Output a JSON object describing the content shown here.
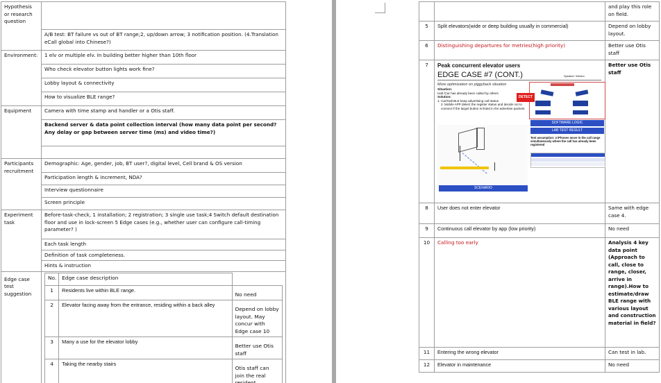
{
  "left_page": {
    "rows": [
      {
        "label": "Hypothesis or research question",
        "items": [
          "",
          "A/B test: BT failure vs out of BT range;2, up/down arrow; 3 notification position. (4.Translation eCall global into Chinese?)"
        ]
      },
      {
        "label": "Environment:",
        "items": [
          "1 elv or multiple elv. In building better higher than 10th floor",
          "Who check elevator button lights work fine?",
          "Lobby layout  & connectivity",
          "How to visualize BLE range?"
        ]
      },
      {
        "label": "Equipment",
        "items": [
          "Camera with time stamp and handler or a Otis staff.",
          "Backend server & data point collection interval (how many data point per second? Any delay or gap between server time (ms) and video time?)",
          ""
        ]
      },
      {
        "label": "Participants recruitment",
        "items": [
          "Demographic: Age, gender, job, BT user?, digital level, Cell brand & OS version",
          "Participation length & increment, NDA?",
          "Interview questionnaire",
          "Screen principle"
        ]
      },
      {
        "label": "Experiment task",
        "items": [
          "Before-task-check, 1 installation; 2 registration; 3 single use task;4 Switch default destination floor and use in lock-screen 5 Edge cases (e.g., whether user can configure call-timing  parameter? )",
          "Each task length",
          "Definition of task completeness.",
          "Hints & instruction"
        ]
      },
      {
        "label": "Edge case test suggestion"
      }
    ],
    "edge_header": {
      "no": "No.",
      "desc": "Edge case description"
    },
    "edge_cases": [
      {
        "no": "1",
        "desc": "Residents live within BLE range.",
        "note": "No need"
      },
      {
        "no": "2",
        "desc": "Elevator facing away from the entrance, residing within a back alley",
        "note": "Depend on lobby layout.  May concur with Edge case 10"
      },
      {
        "no": "3",
        "desc": "Many a use for the elevator lobby",
        "note": "Better use Otis staff"
      },
      {
        "no": "4",
        "desc": "Taking the nearby stairs",
        "note": "Otis staff can join the real resident"
      }
    ]
  },
  "right_page": {
    "rows": [
      {
        "no": "",
        "desc": "",
        "note": "and play this role on field."
      },
      {
        "no": "5",
        "desc": "Split elevators(wide or deep building usually in commercial)",
        "note": "Depend on lobby layout."
      },
      {
        "no": "6",
        "desc": "Distinguishing departures for metries(high priority)",
        "note": "Better use Otis staff"
      },
      {
        "no": "7",
        "desc": "Peak concurrent elevator users",
        "note": "Better use Otis staff"
      },
      {
        "no": "8",
        "desc": "User does not enter elevator",
        "note": "Same with edge case 4."
      },
      {
        "no": "9",
        "desc": "Continuous call elevator by app (low priority)",
        "note": "No need"
      },
      {
        "no": "10",
        "desc": "Calling too early",
        "note": "Analysis 4 key data point (Approach to call, close to range, closer, arrive in range).How to estimate/draw BLE range with various layout and construction material in field?"
      },
      {
        "no": "11",
        "desc": "Entering the wrong elevator",
        "note": "Can test in lab."
      },
      {
        "no": "12",
        "desc": "Elevator in maintenance",
        "note": "No need"
      }
    ],
    "slide": {
      "title": "EDGE CASE #7 (CONT.)",
      "speaker": "Speaker: Wenbo",
      "subtitle": "More optimization on piggyback situation",
      "situation_label": "Situation:",
      "situation": "Hall /Car has already been called  by others",
      "solution_label": "Solution:",
      "solution_1": "1.  Car/Hall BLE keep advertising call status",
      "solution_2": "2.  Mobile APP detect the register status and decide not to connect if the target button is listed in the advertise packets",
      "detect": "DETECT",
      "software_logic": "SOFTWARE LOGIC",
      "lab_test_result": "LAB TEST RESULT",
      "scenario": "SCENARIO",
      "assumption": "Test assumption: 4 iPhones move in the call range simultaneously where the call has already been registered"
    }
  }
}
